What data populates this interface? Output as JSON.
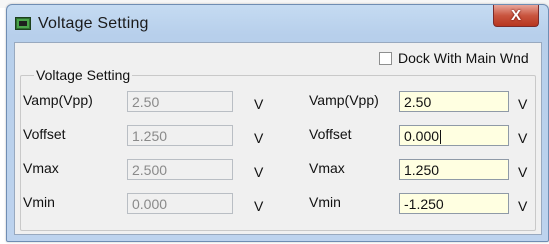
{
  "window": {
    "title": "Voltage Setting",
    "close_label": "X"
  },
  "dock": {
    "label": "Dock With Main Wnd",
    "checked": false
  },
  "group": {
    "title": "Voltage Setting"
  },
  "left": {
    "rows": [
      {
        "label": "Vamp(Vpp)",
        "value": "2.50",
        "unit": "V"
      },
      {
        "label": "Voffset",
        "value": "1.250",
        "unit": "V"
      },
      {
        "label": "Vmax",
        "value": "2.500",
        "unit": "V"
      },
      {
        "label": "Vmin",
        "value": "0.000",
        "unit": "V"
      }
    ]
  },
  "right": {
    "rows": [
      {
        "label": "Vamp(Vpp)",
        "value": "2.50",
        "unit": "V"
      },
      {
        "label": "Voffset",
        "value": "0.000",
        "unit": "V"
      },
      {
        "label": "Vmax",
        "value": "1.250",
        "unit": "V"
      },
      {
        "label": "Vmin",
        "value": "-1.250",
        "unit": "V"
      }
    ]
  },
  "colors": {
    "editable_field_bg": "#ffffe1",
    "readonly_field_bg": "#f0f0f0"
  },
  "icons": {
    "app": "chip-board-icon",
    "close": "close-icon"
  }
}
